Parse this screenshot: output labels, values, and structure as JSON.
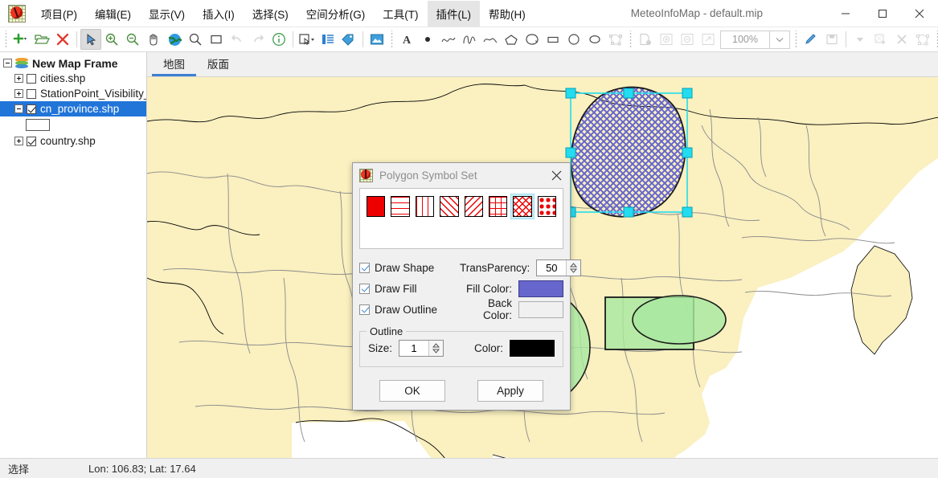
{
  "window": {
    "title": "MeteoInfoMap - default.mip",
    "logo_icon": "app-ladybug-grid-icon",
    "minimize_icon": "minimize-icon",
    "maximize_icon": "maximize-icon",
    "close_icon": "close-icon"
  },
  "menubar": [
    {
      "label": "项目(P)",
      "active": false
    },
    {
      "label": "编辑(E)",
      "active": false
    },
    {
      "label": "显示(V)",
      "active": false
    },
    {
      "label": "插入(I)",
      "active": false
    },
    {
      "label": "选择(S)",
      "active": false
    },
    {
      "label": "空间分析(G)",
      "active": false
    },
    {
      "label": "工具(T)",
      "active": false
    },
    {
      "label": "插件(L)",
      "active": true
    },
    {
      "label": "帮助(H)",
      "active": false
    }
  ],
  "toolbar": {
    "zoom_value": "100%",
    "items": [
      {
        "name": "new-project-button",
        "icon": "plus-dropdown-icon",
        "state": "enabled"
      },
      {
        "name": "open-project-button",
        "icon": "folder-open-icon",
        "state": "enabled"
      },
      {
        "name": "remove-layer-button",
        "icon": "red-x-icon",
        "state": "enabled"
      },
      {
        "name": "select-tool-button",
        "icon": "arrow-cursor-icon",
        "state": "selected"
      },
      {
        "name": "zoom-in-button",
        "icon": "magnifier-plus-icon",
        "state": "enabled"
      },
      {
        "name": "zoom-out-button",
        "icon": "magnifier-minus-icon",
        "state": "enabled"
      },
      {
        "name": "pan-button",
        "icon": "hand-icon",
        "state": "enabled"
      },
      {
        "name": "full-extent-button",
        "icon": "globe-icon",
        "state": "enabled"
      },
      {
        "name": "identify-button",
        "icon": "magnifier-icon",
        "state": "enabled"
      },
      {
        "name": "zoom-to-box-button",
        "icon": "square-icon",
        "state": "enabled"
      },
      {
        "name": "undo-button",
        "icon": "undo-arrow-icon",
        "state": "disabled"
      },
      {
        "name": "redo-button",
        "icon": "redo-arrow-icon",
        "state": "disabled"
      },
      {
        "name": "info-button",
        "icon": "info-circle-icon",
        "state": "enabled"
      },
      {
        "name": "select-by-shape-button",
        "icon": "select-rectangle-dropdown-icon",
        "state": "enabled"
      },
      {
        "name": "attribute-table-button",
        "icon": "attribute-table-icon",
        "state": "enabled"
      },
      {
        "name": "label-button",
        "icon": "tag-icon",
        "state": "enabled"
      },
      {
        "name": "layout-image-button",
        "icon": "picture-icon",
        "state": "enabled"
      },
      {
        "name": "insert-text-button",
        "icon": "letter-a-icon",
        "state": "enabled"
      },
      {
        "name": "insert-point-button",
        "icon": "dot-icon",
        "state": "enabled"
      },
      {
        "name": "insert-polyline-button",
        "icon": "polyline-icon",
        "state": "enabled"
      },
      {
        "name": "insert-freehand-button",
        "icon": "freehand-curve-icon",
        "state": "enabled"
      },
      {
        "name": "insert-curve-button",
        "icon": "curve-icon",
        "state": "enabled"
      },
      {
        "name": "insert-polygon-button",
        "icon": "polygon-icon",
        "state": "enabled"
      },
      {
        "name": "insert-curve-polygon-button",
        "icon": "curve-polygon-icon",
        "state": "enabled"
      },
      {
        "name": "insert-rectangle-button",
        "icon": "rectangle-icon",
        "state": "enabled"
      },
      {
        "name": "insert-circle-button",
        "icon": "circle-icon",
        "state": "enabled"
      },
      {
        "name": "insert-ellipse-button",
        "icon": "ellipse-icon",
        "state": "enabled"
      },
      {
        "name": "edit-vertices-button",
        "icon": "vertex-edit-icon",
        "state": "disabled"
      },
      {
        "name": "page-setup-button",
        "icon": "page-settings-icon",
        "state": "disabled"
      },
      {
        "name": "layout-zoom-in-button",
        "icon": "page-zoom-in-icon",
        "state": "disabled"
      },
      {
        "name": "layout-zoom-out-button",
        "icon": "page-zoom-out-icon",
        "state": "disabled"
      },
      {
        "name": "layout-full-extent-button",
        "icon": "page-full-extent-icon",
        "state": "disabled"
      },
      {
        "name": "edit-layer-button",
        "icon": "pencil-icon",
        "state": "enabled"
      },
      {
        "name": "save-edits-button",
        "icon": "floppy-save-icon",
        "state": "disabled"
      },
      {
        "name": "edit-tool-dropdown",
        "icon": "caret-down-icon",
        "state": "disabled"
      },
      {
        "name": "new-feature-button",
        "icon": "new-feature-icon",
        "state": "disabled"
      },
      {
        "name": "delete-feature-button",
        "icon": "delete-x-icon",
        "state": "disabled"
      },
      {
        "name": "reshape-feature-button",
        "icon": "reshape-vertex-icon",
        "state": "disabled"
      }
    ]
  },
  "layer_tree": {
    "root": {
      "label": "New Map Frame",
      "expander": "minus",
      "icon": "layers-stack-icon"
    },
    "items": [
      {
        "label": "cities.shp",
        "checked": false,
        "expander": "plus",
        "selected": false
      },
      {
        "label": "StationPoint_Visibility_",
        "checked": false,
        "expander": "plus",
        "selected": false
      },
      {
        "label": "cn_province.shp",
        "checked": true,
        "expander": "minus",
        "selected": true
      },
      {
        "label": "country.shp",
        "checked": true,
        "expander": "plus",
        "selected": false
      }
    ],
    "legend_swatch_color": "#ffffff"
  },
  "tabs": [
    {
      "label": "地图",
      "active": true
    },
    {
      "label": "版面",
      "active": false
    }
  ],
  "dialog": {
    "title": "Polygon Symbol Set",
    "icon": "app-ladybug-grid-icon",
    "close_icon": "close-icon",
    "palette": [
      {
        "name": "solid-fill",
        "selected": false
      },
      {
        "name": "horizontal-lines-fill",
        "selected": false
      },
      {
        "name": "vertical-lines-fill",
        "selected": false
      },
      {
        "name": "backward-diagonal-fill",
        "selected": false
      },
      {
        "name": "forward-diagonal-fill",
        "selected": false
      },
      {
        "name": "cross-grid-fill",
        "selected": false
      },
      {
        "name": "diagonal-cross-fill",
        "selected": true
      },
      {
        "name": "dotted-fill",
        "selected": false
      }
    ],
    "palette_color": "#ee0000",
    "checkboxes": [
      {
        "label": "Draw Shape",
        "checked": true
      },
      {
        "label": "Draw Fill",
        "checked": true
      },
      {
        "label": "Draw Outline",
        "checked": true
      }
    ],
    "fields": [
      {
        "label": "TransParency:",
        "value": "50",
        "type": "spinner"
      },
      {
        "label": "Fill Color:",
        "value": "#6666cc",
        "type": "color"
      },
      {
        "label": "Back Color:",
        "value": "#f0f0f0",
        "type": "color"
      }
    ],
    "outline_group": {
      "title": "Outline",
      "size_label": "Size:",
      "size_value": "1",
      "color_label": "Color:",
      "color_value": "#000000"
    },
    "buttons": [
      {
        "label": "OK",
        "name": "ok-button"
      },
      {
        "label": "Apply",
        "name": "apply-button"
      }
    ]
  },
  "map": {
    "land_color": "#faf0c0",
    "sea_color": "#ffffff",
    "graphic_fill": "#a8e8a0",
    "graphic_outline": "#000000",
    "selection_handle_color": "#22dcf0",
    "selected_shape_fill": "#6666cc",
    "shapes": [
      {
        "name": "graphic-polygon",
        "type": "polygon",
        "selected": false
      },
      {
        "name": "graphic-curve-polygon",
        "type": "curve-polygon",
        "selected": true
      },
      {
        "name": "graphic-circle",
        "type": "circle",
        "selected": false
      },
      {
        "name": "graphic-rectangle",
        "type": "rectangle",
        "selected": false
      },
      {
        "name": "graphic-ellipse",
        "type": "ellipse",
        "selected": false
      }
    ]
  },
  "statusbar": {
    "mode": "选择",
    "coords": "Lon: 106.83; Lat: 17.64"
  }
}
